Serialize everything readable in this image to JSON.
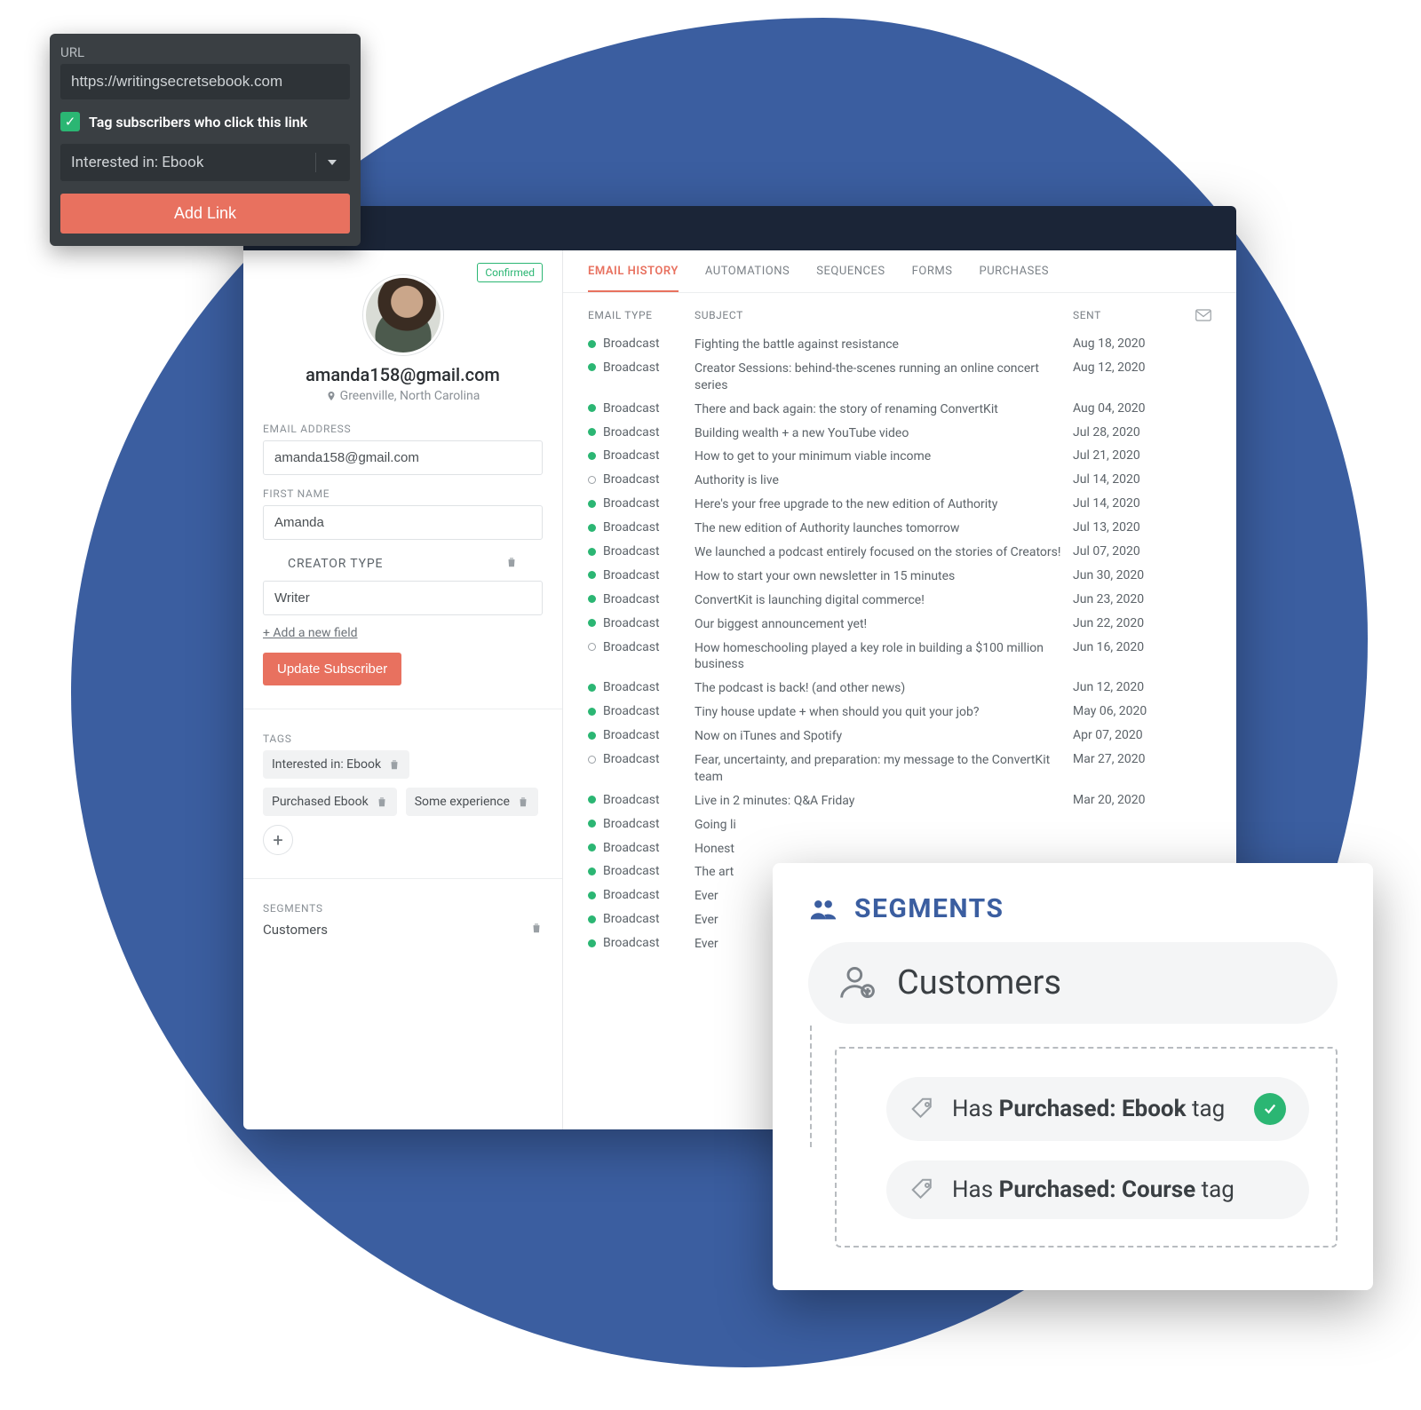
{
  "popup": {
    "url_label": "URL",
    "url_value": "https://writingsecretsebook.com",
    "checkbox_label": "Tag subscribers who click this link",
    "tag_selected": "Interested in: Ebook",
    "button": "Add Link"
  },
  "profile": {
    "status": "Confirmed",
    "email_display": "amanda158@gmail.com",
    "location": "Greenville, North Carolina",
    "fields": {
      "email_label": "EMAIL ADDRESS",
      "email_value": "amanda158@gmail.com",
      "first_name_label": "FIRST NAME",
      "first_name_value": "Amanda",
      "creator_type_label": "CREATOR TYPE",
      "creator_type_value": "Writer"
    },
    "add_field": "+ Add a new field",
    "update_button": "Update Subscriber",
    "tags_label": "TAGS",
    "tags": [
      "Interested in: Ebook",
      "Purchased Ebook",
      "Some experience"
    ],
    "segments_label": "SEGMENTS",
    "segment_value": "Customers"
  },
  "tabs": [
    "EMAIL HISTORY",
    "AUTOMATIONS",
    "SEQUENCES",
    "FORMS",
    "PURCHASES"
  ],
  "table": {
    "headers": {
      "type": "EMAIL TYPE",
      "subject": "SUBJECT",
      "sent": "SENT"
    },
    "rows": [
      {
        "dot": "solid",
        "type": "Broadcast",
        "subject": "Fighting the battle against resistance",
        "sent": "Aug 18, 2020"
      },
      {
        "dot": "solid",
        "type": "Broadcast",
        "subject": "Creator Sessions: behind-the-scenes running an online concert series",
        "sent": "Aug 12, 2020"
      },
      {
        "dot": "solid",
        "type": "Broadcast",
        "subject": "There and back again: the story of renaming ConvertKit",
        "sent": "Aug 04, 2020"
      },
      {
        "dot": "solid",
        "type": "Broadcast",
        "subject": "Building wealth + a new YouTube video",
        "sent": "Jul 28, 2020"
      },
      {
        "dot": "solid",
        "type": "Broadcast",
        "subject": "How to get to your minimum viable income",
        "sent": "Jul 21, 2020"
      },
      {
        "dot": "hollow",
        "type": "Broadcast",
        "subject": "Authority is live",
        "sent": "Jul 14, 2020"
      },
      {
        "dot": "solid",
        "type": "Broadcast",
        "subject": "Here's your free upgrade to the new edition of Authority",
        "sent": "Jul 14, 2020"
      },
      {
        "dot": "solid",
        "type": "Broadcast",
        "subject": "The new edition of Authority launches tomorrow",
        "sent": "Jul 13, 2020"
      },
      {
        "dot": "solid",
        "type": "Broadcast",
        "subject": "We launched a podcast entirely focused on the stories of Creators!",
        "sent": "Jul 07, 2020"
      },
      {
        "dot": "solid",
        "type": "Broadcast",
        "subject": "How to start your own newsletter in 15 minutes",
        "sent": "Jun 30, 2020"
      },
      {
        "dot": "solid",
        "type": "Broadcast",
        "subject": "ConvertKit is launching digital commerce!",
        "sent": "Jun 23, 2020"
      },
      {
        "dot": "solid",
        "type": "Broadcast",
        "subject": "Our biggest announcement yet!",
        "sent": "Jun 22, 2020"
      },
      {
        "dot": "hollow",
        "type": "Broadcast",
        "subject": "How homeschooling played a key role in building a $100 million business",
        "sent": "Jun 16, 2020"
      },
      {
        "dot": "solid",
        "type": "Broadcast",
        "subject": "The podcast is back! (and other news)",
        "sent": "Jun 12, 2020"
      },
      {
        "dot": "solid",
        "type": "Broadcast",
        "subject": "Tiny house update + when should you quit your job?",
        "sent": "May 06, 2020"
      },
      {
        "dot": "solid",
        "type": "Broadcast",
        "subject": "Now on iTunes and Spotify",
        "sent": "Apr 07, 2020"
      },
      {
        "dot": "hollow",
        "type": "Broadcast",
        "subject": "Fear, uncertainty, and preparation: my message to the ConvertKit team",
        "sent": "Mar 27, 2020"
      },
      {
        "dot": "solid",
        "type": "Broadcast",
        "subject": "Live in 2 minutes: Q&A Friday",
        "sent": "Mar 20, 2020"
      },
      {
        "dot": "solid",
        "type": "Broadcast",
        "subject": "Going li",
        "sent": ""
      },
      {
        "dot": "solid",
        "type": "Broadcast",
        "subject": "Honest",
        "sent": ""
      },
      {
        "dot": "solid",
        "type": "Broadcast",
        "subject": "The art",
        "sent": ""
      },
      {
        "dot": "solid",
        "type": "Broadcast",
        "subject": "Ever",
        "sent": ""
      },
      {
        "dot": "solid",
        "type": "Broadcast",
        "subject": "Ever",
        "sent": ""
      },
      {
        "dot": "solid",
        "type": "Broadcast",
        "subject": "Ever",
        "sent": ""
      }
    ]
  },
  "segments_card": {
    "title": "SEGMENTS",
    "pill": "Customers",
    "rules": [
      {
        "prefix": "Has ",
        "bold": "Purchased: Ebook",
        "suffix": " tag",
        "ok": true
      },
      {
        "prefix": "Has ",
        "bold": "Purchased: Course",
        "suffix": " tag",
        "ok": false
      }
    ]
  }
}
